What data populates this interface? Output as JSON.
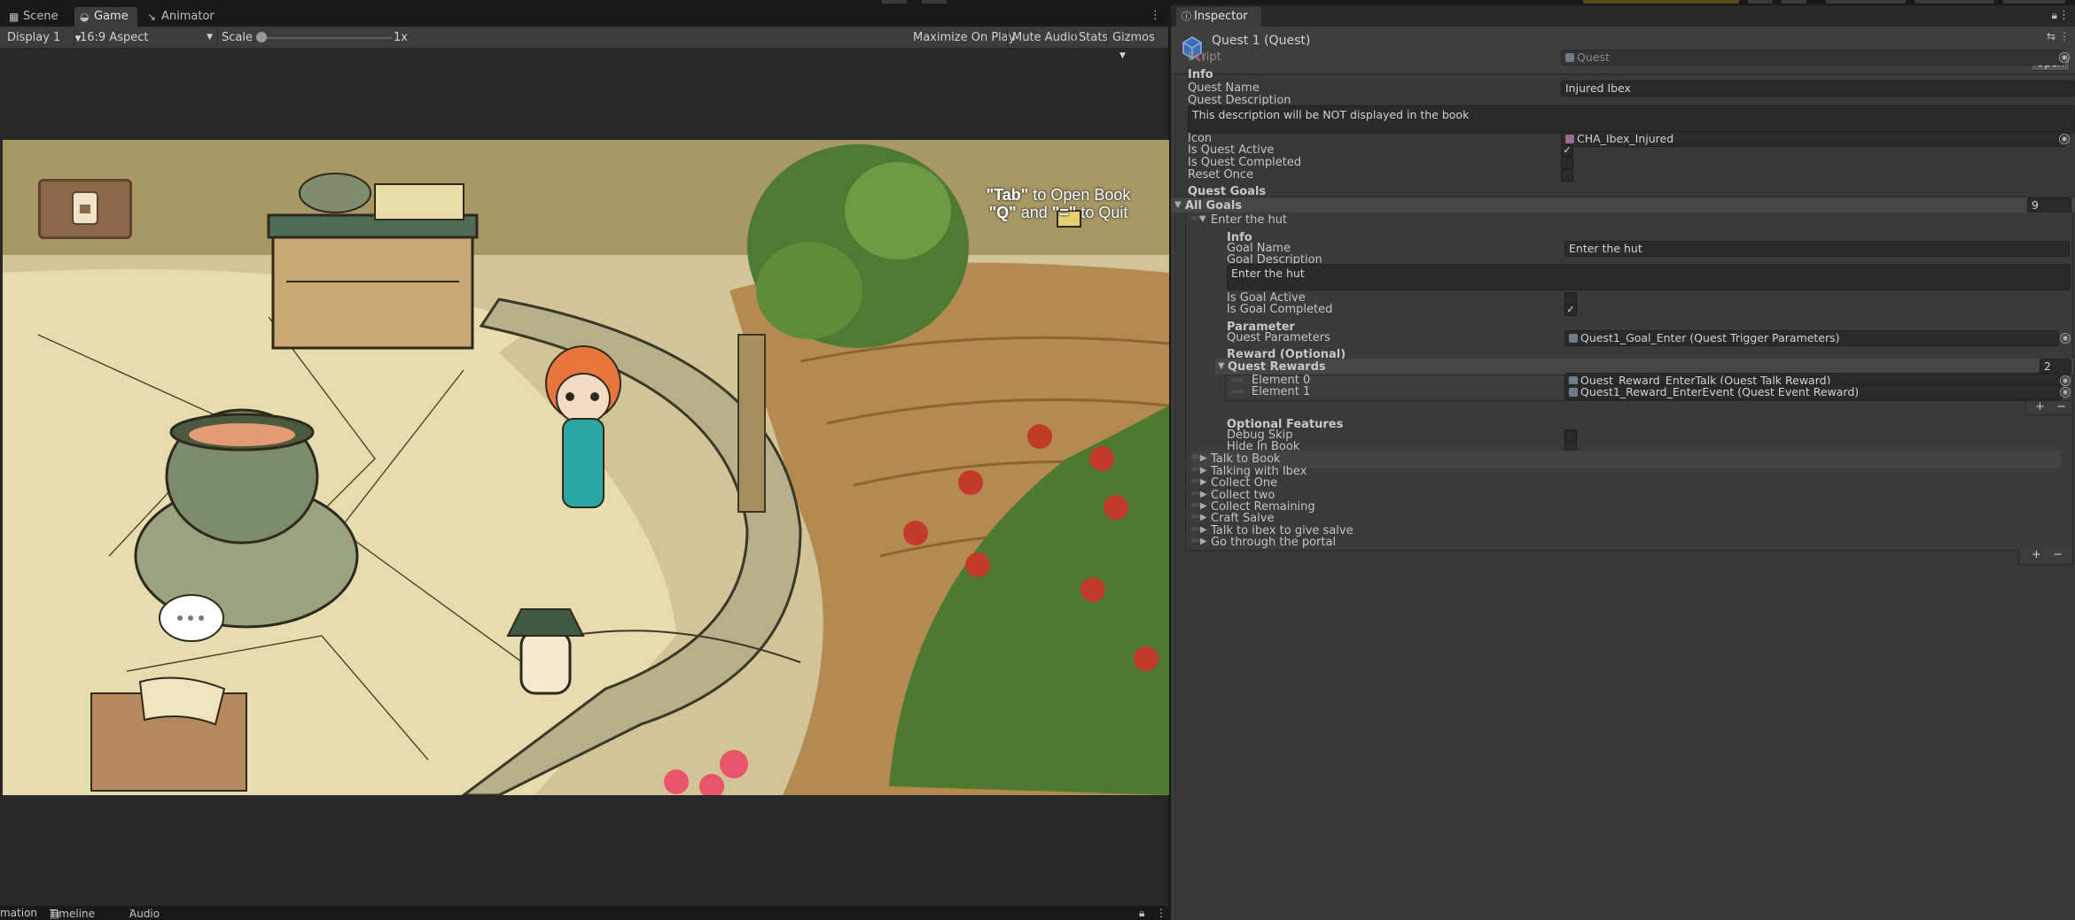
{
  "left_tabs": [
    {
      "label": "Scene",
      "icon": "grid-icon"
    },
    {
      "label": "Game",
      "icon": "gamepad-icon"
    },
    {
      "label": "Animator",
      "icon": "animator-icon"
    }
  ],
  "game_toolbar": {
    "display": "Display 1",
    "aspect": "16:9 Aspect",
    "scale_label": "Scale",
    "scale_value": "1x",
    "scale_fraction": 0.0,
    "maximize": "Maximize On Play",
    "mute": "Mute Audio",
    "stats": "Stats",
    "gizmos": "Gizmos"
  },
  "game_view": {
    "hint_tab": "\"Tab\"",
    "hint_tab_rest": " to Open Book",
    "hint_q": "\"Q\"",
    "hint_and": " and ",
    "hint_eq": "\"=\"",
    "hint_quit": " to Quit"
  },
  "bottom_tabs": [
    {
      "label": "mation",
      "icon": ""
    },
    {
      "label": "Timeline",
      "icon": "timeline-icon"
    },
    {
      "label": "Audio Mixer",
      "icon": "mixer-icon"
    }
  ],
  "inspector": {
    "tab": "Inspector",
    "title": "Quest 1 (Quest)",
    "open_button": "Open",
    "script_label": "Script",
    "script_value": "Quest",
    "info_header": "Info",
    "quest_name_label": "Quest Name",
    "quest_name_value": "Injured Ibex",
    "quest_desc_label": "Quest Description",
    "quest_desc_value": "This description will be NOT displayed in the book",
    "icon_label": "Icon",
    "icon_value": "CHA_Ibex_Injured",
    "is_active_label": "Is Quest Active",
    "is_active": true,
    "is_completed_label": "Is Quest Completed",
    "is_completed": false,
    "reset_once_label": "Reset Once",
    "reset_once": false,
    "goals_header": "Quest Goals",
    "all_goals_label": "All Goals",
    "all_goals_count": "9",
    "goal0": {
      "title": "Enter the hut",
      "info_header": "Info",
      "goal_name_label": "Goal Name",
      "goal_name_value": "Enter the hut",
      "goal_desc_label": "Goal Description",
      "goal_desc_value": "Enter the hut",
      "is_goal_active_label": "Is Goal Active",
      "is_goal_active": false,
      "is_goal_completed_label": "Is Goal Completed",
      "is_goal_completed": true,
      "parameter_header": "Parameter",
      "quest_params_label": "Quest Parameters",
      "quest_params_value": "Quest1_Goal_Enter (Quest Trigger Parameters)",
      "reward_header": "Reward (Optional)",
      "rewards_label": "Quest Rewards",
      "rewards_count": "2",
      "rewards": [
        {
          "label": "Element 0",
          "value": "Quest_Reward_EnterTalk (Quest Talk Reward)"
        },
        {
          "label": "Element 1",
          "value": "Quest1_Reward_EnterEvent (Quest Event Reward)"
        }
      ],
      "optional_header": "Optional Features",
      "debug_skip_label": "Debug Skip",
      "debug_skip": false,
      "hide_in_book_label": "Hide In Book",
      "hide_in_book": false
    },
    "other_goals": [
      "Talk to Book",
      "Talking with Ibex",
      "Collect One",
      "Collect two",
      "Collect Remaining",
      "Craft Salve",
      "Talk to ibex to give salve",
      "Go through the portal"
    ],
    "plus": "+",
    "minus": "−",
    "check_glyph": "✓"
  }
}
